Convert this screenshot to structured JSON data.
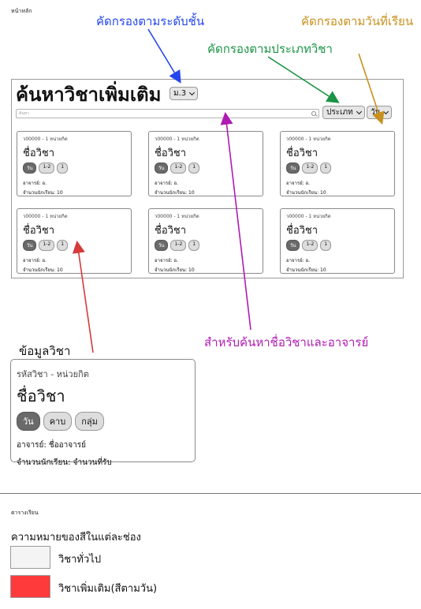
{
  "top_label": "หน้าหลัก",
  "annotations": {
    "level_filter": "คัดกรองตามระดับชั้น",
    "day_filter": "คัดกรองตามวันที่เรียน",
    "type_filter": "คัดกรองตามประเภทวิชา",
    "search_note": "สำหรับค้นหาชื่อวิชาและอาจารย์",
    "course_info": "ข้อมูลวิชา"
  },
  "colors": {
    "level_filter": "#2345ee",
    "day_filter": "#c8901c",
    "type_filter": "#1a9445",
    "search_note": "#b01bb3",
    "course_info": "#d83a3a",
    "general_course": "#f4f4f4",
    "extra_course": "#ff3a3a"
  },
  "mock": {
    "title": "ค้นหาวิชาเพิ่มเติม",
    "level_select": "ม.3",
    "type_select": "ประเภท",
    "day_select": "วัน",
    "search_placeholder": "ค้นหา"
  },
  "cards": [
    {
      "code": "ว00000 - 1 หน่วยกิต",
      "name": "ชื่อวิชา",
      "chips": [
        "วัน",
        "1-2",
        "1"
      ],
      "teacher": "อาจารย์: อ.",
      "students": "จำนวนนักเรียน: 10"
    },
    {
      "code": "ว00000 - 1 หน่วยกิต",
      "name": "ชื่อวิชา",
      "chips": [
        "วัน",
        "1-2",
        "1"
      ],
      "teacher": "อาจารย์: อ.",
      "students": "จำนวนนักเรียน: 10"
    },
    {
      "code": "ว00000 - 1 หน่วยกิต",
      "name": "ชื่อวิชา",
      "chips": [
        "วัน",
        "1-2",
        "1"
      ],
      "teacher": "อาจารย์: อ.",
      "students": "จำนวนนักเรียน: 10"
    },
    {
      "code": "ว00000 - 1 หน่วยกิต",
      "name": "ชื่อวิชา",
      "chips": [
        "วัน",
        "1-2",
        "1"
      ],
      "teacher": "อาจารย์: อ.",
      "students": "จำนวนนักเรียน: 10"
    },
    {
      "code": "ว00000 - 1 หน่วยกิต",
      "name": "ชื่อวิชา",
      "chips": [
        "วัน",
        "1-2",
        "1"
      ],
      "teacher": "อาจารย์: อ.",
      "students": "จำนวนนักเรียน: 10"
    },
    {
      "code": "ว00000 - 1 หน่วยกิต",
      "name": "ชื่อวิชา",
      "chips": [
        "วัน",
        "1-2",
        "1"
      ],
      "teacher": "อาจารย์: อ.",
      "students": "จำนวนนักเรียน: 10"
    }
  ],
  "detail_card": {
    "code": "รหัสวิชา - หน่วยกิต",
    "name": "ชื่อวิชา",
    "chips": [
      "วัน",
      "คาบ",
      "กลุ่ม"
    ],
    "teacher": "อาจารย์: ชื่ออาจารย์",
    "students": "จำนวนนักเรียน: จำนวนที่รับ"
  },
  "schedule": {
    "label": "ตารางเรียน",
    "legend_title": "ความหมายของสีในแต่ละช่อง",
    "legend_items": [
      {
        "label": "วิชาทั่วไป"
      },
      {
        "label": "วิชาเพิ่มเติม(สีตามวัน)"
      }
    ]
  }
}
